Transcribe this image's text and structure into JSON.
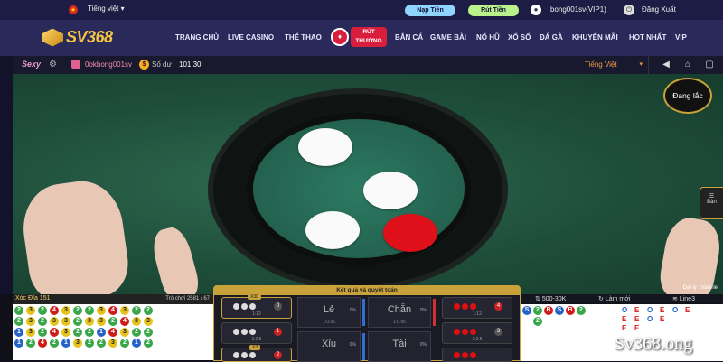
{
  "topbar": {
    "language": "Tiếng việt",
    "deposit_label": "Nạp Tiền",
    "withdraw_label": "Rút Tiền",
    "user": "bong001sv(VIP1)",
    "logout_label": "Đăng Xuất",
    "language_caret": "▾"
  },
  "nav": {
    "logo": "SV368",
    "items_left": [
      "TRANG CHỦ",
      "LIVE CASINO",
      "THỂ THAO"
    ],
    "promo_line1": "RÚT",
    "promo_line2": "THƯỞNG",
    "items_right": [
      "BẮN CÁ",
      "GAME BÀI",
      "NỔ HŨ",
      "XỔ SỐ",
      "ĐÁ GÀ",
      "KHUYẾN MÃI",
      "HOT NHẤT",
      "VIP"
    ]
  },
  "gamebar": {
    "brand": "Sexy",
    "username": "0okbong001sv",
    "balance_label": "Số dư",
    "balance": "101.30",
    "language": "Tiếng Việt",
    "language_caret": "▾"
  },
  "video": {
    "shake_status": "Đang lắc",
    "side_tab": "Bàn",
    "dealer": "Đại lý : Valerie",
    "discs": [
      "white",
      "white",
      "white",
      "red"
    ]
  },
  "room": {
    "name": "Xóc Đĩa 151",
    "round": "Trò chơi 2581 / 67"
  },
  "bead_road": [
    [
      "2",
      "3",
      "2",
      "4",
      "3",
      "2",
      "2",
      "3",
      "4",
      "3",
      "2",
      "2"
    ],
    [
      "2",
      "3",
      "2",
      "3",
      "3",
      "2",
      "3",
      "3",
      "2",
      "4",
      "3",
      "3"
    ],
    [
      "1",
      "3",
      "2",
      "4",
      "3",
      "2",
      "2",
      "1",
      "4",
      "3",
      "2",
      "2"
    ],
    [
      "1",
      "2",
      "4",
      "2",
      "1",
      "3",
      "2",
      "2",
      "3",
      "2",
      "1",
      "2"
    ]
  ],
  "panel": {
    "title": "Kết quả và quyết toán",
    "x30_label": "X30",
    "x3_label": "X3",
    "odds_small": "1:12",
    "odds_mid": "1:2.5",
    "odds_even": "1:0.96",
    "bet_le": "Lẻ",
    "bet_chan": "Chẵn",
    "bet_xiu": "Xỉu",
    "bet_tai": "Tài",
    "pct_le": "0%",
    "pct_chan": "0%",
    "pct_xiu": "0%",
    "pct_tai": "0%",
    "chip_left_top": "0",
    "chip_left_mid": "1",
    "chip_left_bot": "2",
    "chip_right_top": "4",
    "chip_right_mid": "3"
  },
  "right_bar": {
    "limit": "500-30K",
    "refresh_label": "Làm mới",
    "line": "Line3"
  },
  "big_road": {
    "row1": [
      "S",
      "2",
      "B",
      "S",
      "B",
      "2"
    ],
    "row2": [
      "2"
    ],
    "e_row1": [
      "O",
      "E",
      "O",
      "E",
      "O",
      "E"
    ],
    "e_row2": [
      "E",
      "E",
      "O",
      "E"
    ],
    "e_row3": [
      "E",
      "E"
    ]
  },
  "watermark": "Sv368.ong",
  "colors": {
    "accent_gold": "#c9a23a",
    "bead_blue": "#2563c9",
    "bead_red": "#d11a1a",
    "bead_yellow": "#e6c21a",
    "bead_green": "#3aa64a"
  }
}
